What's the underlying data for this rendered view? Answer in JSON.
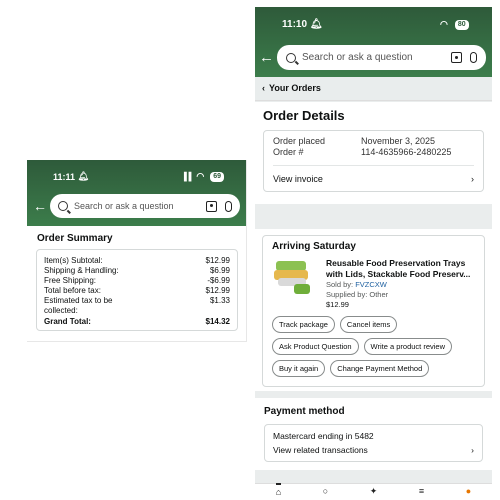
{
  "left": {
    "status": {
      "time": "11:11",
      "battery": "69"
    },
    "search": {
      "placeholder": "Search or ask a question"
    },
    "summary": {
      "title": "Order Summary",
      "rows": [
        {
          "label": "Item(s) Subtotal:",
          "value": "$12.99"
        },
        {
          "label": "Shipping & Handling:",
          "value": "$6.99"
        },
        {
          "label": "Free Shipping:",
          "value": "-$6.99"
        },
        {
          "label": "Total before tax:",
          "value": "$12.99"
        },
        {
          "label": "Estimated tax to be collected:",
          "value": "$1.33"
        }
      ],
      "grand_total": {
        "label": "Grand Total:",
        "value": "$14.32"
      }
    }
  },
  "right": {
    "status": {
      "time": "11:10",
      "battery": "80"
    },
    "search": {
      "placeholder": "Search or ask a question"
    },
    "breadcrumb": "Your Orders",
    "order_details": {
      "title": "Order Details",
      "placed_label": "Order placed",
      "placed_value": "November 3, 2025",
      "number_label": "Order #",
      "number_value": "114-4635966-2480225",
      "view_invoice": "View invoice"
    },
    "arriving": {
      "heading": "Arriving Saturday",
      "item_title_1": "Reusable Food Preservation Trays",
      "item_title_2": "with Lids, Stackable Food Preserv...",
      "sold_by_label": "Sold by:",
      "sold_by_value": "FVZCXW",
      "supplied_by": "Supplied by: Other",
      "price": "$12.99",
      "buttons": [
        "Track package",
        "Cancel items",
        "Ask Product Question",
        "Write a product review",
        "Buy it again",
        "Change Payment Method"
      ]
    },
    "payment": {
      "title": "Payment method",
      "card": "Mastercard  ending in 5482",
      "related": "View related transactions"
    }
  },
  "colors": {
    "header_green": "#2e5a3a",
    "link_blue": "#2162a1"
  },
  "icons": [
    "back-arrow-icon",
    "search-icon",
    "camera-icon",
    "mic-icon",
    "chevron-right-icon",
    "home-icon",
    "person-icon",
    "ai-icon",
    "menu-icon",
    "cart-icon"
  ]
}
